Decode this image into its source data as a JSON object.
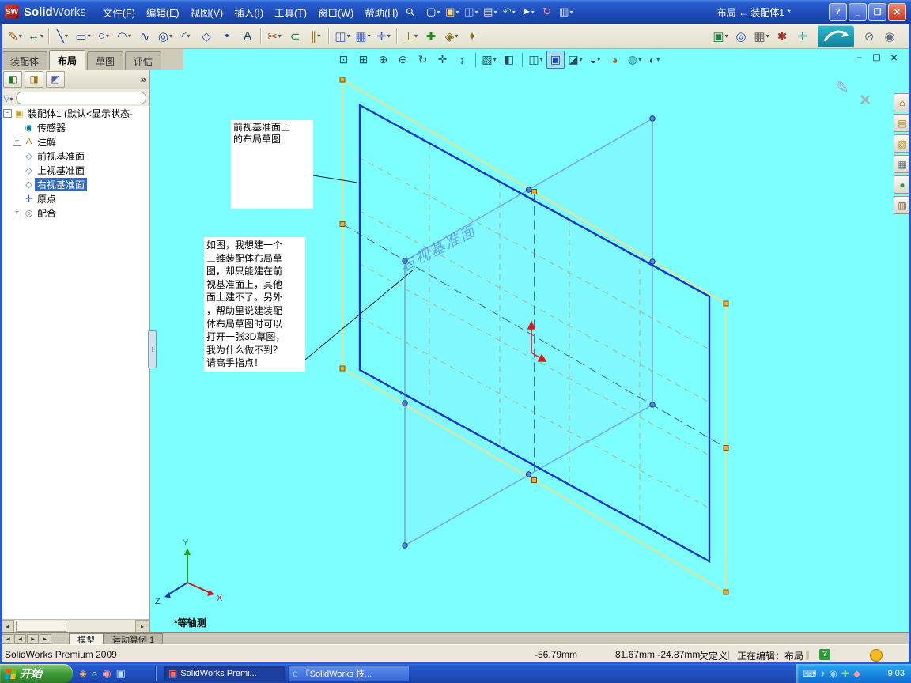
{
  "titlebar": {
    "app_name": {
      "bold": "Solid",
      "light": "Works"
    },
    "menus": [
      "文件(F)",
      "编辑(E)",
      "视图(V)",
      "插入(I)",
      "工具(T)",
      "窗口(W)",
      "帮助(H)"
    ],
    "std_icons": [
      {
        "name": "new-document-icon",
        "g": "▢",
        "c": "#ffffff",
        "dd": true
      },
      {
        "name": "open-document-icon",
        "g": "▣",
        "c": "#ffd878",
        "dd": true
      },
      {
        "name": "save-icon",
        "g": "◫",
        "c": "#a8c8ff",
        "dd": true
      },
      {
        "name": "print-icon",
        "g": "▤",
        "c": "#e0e6f0",
        "dd": true
      },
      {
        "name": "undo-icon",
        "g": "↶",
        "c": "#a8e8a8",
        "dd": true
      },
      {
        "name": "select-icon",
        "g": "➤",
        "c": "#ffffff",
        "dd": true
      },
      {
        "name": "rebuild-icon",
        "g": "↻",
        "c": "#ff9a9a"
      },
      {
        "name": "options-icon",
        "g": "▥",
        "c": "#e0e6f0",
        "dd": true
      }
    ],
    "doc_label": "布局 ← 装配体1 *",
    "window_buttons": [
      {
        "name": "help-button",
        "g": "?"
      },
      {
        "name": "minimize-button",
        "g": "_"
      },
      {
        "name": "restore-button",
        "g": "❐"
      },
      {
        "name": "close-button",
        "g": "✕",
        "cls": "close"
      }
    ]
  },
  "toolbar": {
    "left_icons": [
      {
        "name": "sketch-icon",
        "g": "✎",
        "c": "#b05a10",
        "dd": true
      },
      {
        "name": "smart-dimension-icon",
        "g": "↔",
        "c": "#007878",
        "dd": true
      },
      {
        "cls": "sep"
      },
      {
        "name": "line-icon",
        "g": "╲",
        "c": "#2444b0",
        "dd": true
      },
      {
        "name": "rectangle-icon",
        "g": "▭",
        "c": "#2444b0",
        "dd": true
      },
      {
        "name": "circle-icon",
        "g": "○",
        "c": "#2444b0",
        "dd": true
      },
      {
        "name": "arc-icon",
        "g": "◠",
        "c": "#2444b0",
        "dd": true
      },
      {
        "name": "spline-icon",
        "g": "∿",
        "c": "#2444b0"
      },
      {
        "name": "ellipse-icon",
        "g": "◎",
        "c": "#2444b0",
        "dd": true
      },
      {
        "name": "fillet-icon",
        "g": "◜",
        "c": "#2444b0",
        "dd": true
      },
      {
        "name": "polygon-icon",
        "g": "◇",
        "c": "#2444b0"
      },
      {
        "name": "point-icon",
        "g": "•",
        "c": "#2444b0"
      },
      {
        "name": "text-icon",
        "g": "A",
        "c": "#204070"
      },
      {
        "cls": "sep"
      },
      {
        "name": "trim-entities-icon",
        "g": "✂",
        "c": "#a04818",
        "dd": true
      },
      {
        "name": "convert-entities-icon",
        "g": "⊂",
        "c": "#208040"
      },
      {
        "name": "offset-entities-icon",
        "g": "∥",
        "c": "#a07800",
        "dd": true
      },
      {
        "cls": "sep"
      },
      {
        "name": "mirror-entities-icon",
        "g": "◫",
        "c": "#4868c8",
        "dd": true
      },
      {
        "name": "linear-pattern-icon",
        "g": "▦",
        "c": "#4868c8",
        "dd": true
      },
      {
        "name": "move-entities-icon",
        "g": "✛",
        "c": "#4868c8",
        "dd": true
      },
      {
        "cls": "sep"
      },
      {
        "name": "display-relations-icon",
        "g": "⊥",
        "c": "#887020",
        "dd": true
      },
      {
        "name": "repair-sketch-icon",
        "g": "✚",
        "c": "#1a8a1a"
      },
      {
        "name": "quick-snaps-icon",
        "g": "◈",
        "c": "#887020",
        "dd": true
      },
      {
        "name": "rapid-sketch-icon",
        "g": "✦",
        "c": "#887020"
      }
    ],
    "right_icons": [
      {
        "name": "insert-components-icon",
        "g": "▣",
        "c": "#208048",
        "dd": true
      },
      {
        "name": "mate-icon",
        "g": "◎",
        "c": "#2050c0"
      },
      {
        "name": "component-pattern-icon",
        "g": "▦",
        "c": "#606060",
        "dd": true
      },
      {
        "name": "smart-fasteners-icon",
        "g": "✱",
        "c": "#b03030"
      },
      {
        "name": "move-component-icon",
        "g": "✛",
        "c": "#208080"
      }
    ],
    "extra_icons": [
      {
        "name": "attachment-icon",
        "g": "⊘",
        "c": "#607080"
      },
      {
        "name": "selection-filter-icon",
        "g": "◉",
        "c": "#607080"
      }
    ]
  },
  "command_tabs": [
    {
      "label": "装配体",
      "name": "tab-assembly"
    },
    {
      "label": "布局",
      "cls": "active",
      "name": "tab-layout"
    },
    {
      "label": "草图",
      "name": "tab-sketch"
    },
    {
      "label": "评估",
      "name": "tab-evaluate"
    }
  ],
  "headsup_icons": [
    {
      "name": "zoom-to-fit-icon",
      "g": "⊡",
      "c": "#2a4a5a"
    },
    {
      "name": "zoom-to-area-icon",
      "g": "⊞",
      "c": "#2a4a5a"
    },
    {
      "name": "zoom-in-out-icon",
      "g": "⊕",
      "c": "#2a4a5a"
    },
    {
      "name": "zoom-to-selection-icon",
      "g": "⊖",
      "c": "#2a4a5a"
    },
    {
      "name": "rotate-view-icon",
      "g": "↻",
      "c": "#2a4a5a"
    },
    {
      "name": "pan-icon",
      "g": "✛",
      "c": "#2a4a5a"
    },
    {
      "name": "roll-view-icon",
      "g": "↕",
      "c": "#2a4a5a"
    },
    {
      "cls": "sep"
    },
    {
      "name": "standard-views-icon",
      "g": "▧",
      "c": "#2a4a5a",
      "dd": true
    },
    {
      "name": "section-view-icon",
      "g": "◧",
      "c": "#2a4a5a"
    },
    {
      "cls": "sep"
    },
    {
      "name": "view-orientation-icon",
      "g": "◫",
      "c": "#2a4a5a",
      "dd": true
    },
    {
      "name": "display-style-shaded-icon",
      "g": "▣",
      "c": "#1a4ab0",
      "cls": "active"
    },
    {
      "name": "display-style-icon",
      "g": "◪",
      "c": "#2a4a5a",
      "dd": true
    },
    {
      "name": "hide-show-items-icon",
      "g": "◒",
      "c": "#2a4a5a",
      "dd": true
    },
    {
      "name": "edit-appearance-icon",
      "g": "◕",
      "c": "#b06020"
    },
    {
      "name": "apply-scene-icon",
      "g": "◍",
      "c": "#208080",
      "dd": true
    },
    {
      "name": "view-settings-icon",
      "g": "◐",
      "c": "#2a4a5a",
      "dd": true
    }
  ],
  "doc_window_buttons": [
    {
      "name": "doc-minimize-button",
      "g": "–"
    },
    {
      "name": "doc-restore-button",
      "g": "❐"
    },
    {
      "name": "doc-close-button",
      "g": "✕"
    }
  ],
  "panel": {
    "header_icons": [
      {
        "name": "featuremanager-tab-icon",
        "g": "◧",
        "c": "#2a7a2a"
      },
      {
        "name": "propertymanager-tab-icon",
        "g": "◨",
        "c": "#a07818"
      },
      {
        "name": "configurationmanager-tab-icon",
        "g": "◩",
        "c": "#5060a0"
      }
    ],
    "chevron": "»",
    "tree": [
      {
        "label": "装配体1 (默认<显示状态-",
        "icon": "▣",
        "c": "#c8a020",
        "depth": 0,
        "exp": "-",
        "name": "tree-item-assembly-root"
      },
      {
        "label": "传感器",
        "icon": "◉",
        "c": "#0080a0",
        "depth": 1,
        "exp": "",
        "name": "tree-item-sensors"
      },
      {
        "label": "注解",
        "icon": "A",
        "c": "#c07000",
        "depth": 1,
        "exp": "+",
        "name": "tree-item-annotations"
      },
      {
        "label": "前视基准面",
        "icon": "◇",
        "c": "#4080c0",
        "depth": 1,
        "exp": "",
        "name": "tree-item-front-plane"
      },
      {
        "label": "上视基准面",
        "icon": "◇",
        "c": "#4080c0",
        "depth": 1,
        "exp": "",
        "name": "tree-item-top-plane"
      },
      {
        "label": "右视基准面",
        "icon": "◇",
        "c": "#4080c0",
        "depth": 1,
        "exp": "",
        "cls": "selected",
        "name": "tree-item-right-plane"
      },
      {
        "label": "原点",
        "icon": "✛",
        "c": "#2050c0",
        "depth": 1,
        "exp": "",
        "name": "tree-item-origin"
      },
      {
        "label": "配合",
        "icon": "◎",
        "c": "#707070",
        "depth": 1,
        "exp": "+",
        "name": "tree-item-mates"
      }
    ]
  },
  "viewport": {
    "plane_label": "右视基准面",
    "view_label": "*等轴测",
    "note1": "前视基准面上\n的布局草图",
    "note2": "如图，我想建一个\n三维装配体布局草\n图，却只能建在前\n视基准面上，其他\n面上建不了。另外\n，帮助里说建装配\n体布局草图时可以\n打开一张3D草图，\n我为什么做不到？\n请高手指点！",
    "confirm_sketch_icon": "✎",
    "confirm_close_icon": "✕",
    "triad": {
      "x": "X",
      "y": "Y",
      "z": "Z"
    }
  },
  "taskpane_icons": [
    {
      "name": "solidworks-resources-icon",
      "g": "⌂",
      "c": "#a05010"
    },
    {
      "name": "design-library-icon",
      "g": "▤",
      "c": "#b08020"
    },
    {
      "name": "file-explorer-icon",
      "g": "▨",
      "c": "#c09020"
    },
    {
      "name": "view-palette-icon",
      "g": "▦",
      "c": "#607080"
    },
    {
      "name": "appearances-icon",
      "g": "●",
      "c": "#2a9a5a"
    },
    {
      "name": "custom-properties-icon",
      "g": "▥",
      "c": "#806040"
    }
  ],
  "model_tabs": {
    "nav": [
      "|◀",
      "◀",
      "▶",
      "▶|"
    ],
    "tabs": [
      {
        "label": "模型",
        "cls": "active",
        "name": "model-tab"
      },
      {
        "label": "运动算例 1",
        "name": "motion-study-tab"
      }
    ]
  },
  "statusbar": {
    "product": "SolidWorks Premium 2009",
    "coord_x": "-56.79mm",
    "coord_yz": "81.67mm  -24.87mm",
    "definition": "欠定义",
    "separator": "|",
    "editing": "正在编辑：布局",
    "grip": "∥"
  },
  "taskbar": {
    "start": "开始",
    "quick_launch": [
      {
        "name": "quicklaunch-icon-1",
        "g": "◈",
        "c": "#ffb060"
      },
      {
        "name": "ie-icon",
        "g": "e",
        "c": "#9fd8ff"
      },
      {
        "name": "quicklaunch-icon-3",
        "g": "◉",
        "c": "#ff9a9a"
      },
      {
        "name": "quicklaunch-icon-4",
        "g": "▣",
        "c": "#c0e0ff"
      }
    ],
    "tasks": [
      {
        "label": "SolidWorks Premi...",
        "g": "▣",
        "c": "#ff6a5a",
        "cls": "pressed",
        "name": "taskbar-button-solidworks"
      },
      {
        "label": "『SolidWorks 技...",
        "g": "e",
        "c": "#8fd4ff",
        "name": "taskbar-button-browser"
      }
    ],
    "tray_icons": [
      {
        "name": "ime-keyboard-icon",
        "g": "⌨",
        "c": "#e8f0ff"
      },
      {
        "name": "volume-icon",
        "g": "♪",
        "c": "#e8f0ff"
      },
      {
        "name": "network-icon",
        "g": "◉",
        "c": "#9fd0ff"
      },
      {
        "name": "antivirus-icon",
        "g": "✚",
        "c": "#7fe08f"
      },
      {
        "name": "messenger-icon",
        "g": "◆",
        "c": "#ff9aa0"
      }
    ],
    "clock": "9:03"
  }
}
